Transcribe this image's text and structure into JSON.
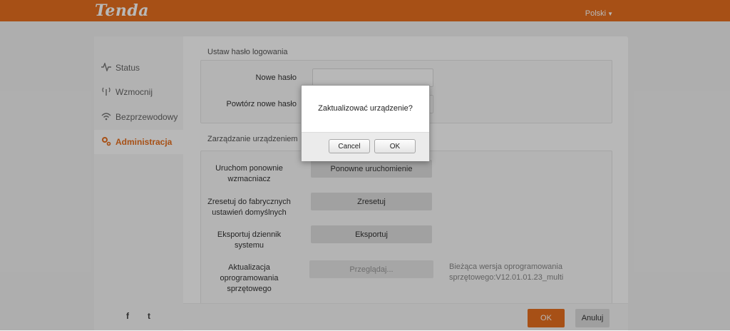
{
  "header": {
    "logo": "Tenda",
    "language": "Polski"
  },
  "sidebar": {
    "items": [
      {
        "label": "Status",
        "icon": "pulse-icon"
      },
      {
        "label": "Wzmocnij",
        "icon": "antenna-icon"
      },
      {
        "label": "Bezprzewodowy",
        "icon": "wifi-icon"
      },
      {
        "label": "Administracja",
        "icon": "gear-icon",
        "active": true
      }
    ],
    "social": [
      "f",
      "t"
    ]
  },
  "password_section": {
    "title": "Ustaw hasło logowania",
    "new_password_label": "Nowe hasło",
    "repeat_password_label": "Powtórz nowe hasło",
    "new_password_value": "",
    "repeat_password_value": ""
  },
  "device_section": {
    "title": "Zarządzanie urządzeniem",
    "reboot_label_1": "Uruchom ponownie",
    "reboot_label_2": "wzmacniacz",
    "reboot_button": "Ponowne uruchomienie",
    "reset_label_1": "Zresetuj do fabrycznych",
    "reset_label_2": "ustawień domyślnych",
    "reset_button": "Zresetuj",
    "export_label_1": "Eksportuj dziennik",
    "export_label_2": "systemu",
    "export_button": "Eksportuj",
    "firmware_label_1": "Aktualizacja",
    "firmware_label_2": "oprogramowania",
    "firmware_label_3": "sprzętowego",
    "browse_button": "Przeglądaj...",
    "version_line_1": "Bieżąca wersja oprogramowania",
    "version_line_2": "sprzętowego:V12.01.01.23_multi"
  },
  "footer": {
    "ok_label": "OK",
    "cancel_label": "Anuluj"
  },
  "dialog": {
    "message": "Zaktualizować urządzenie?",
    "cancel_label": "Cancel",
    "ok_label": "OK"
  },
  "colors": {
    "brand": "#e8701f"
  }
}
